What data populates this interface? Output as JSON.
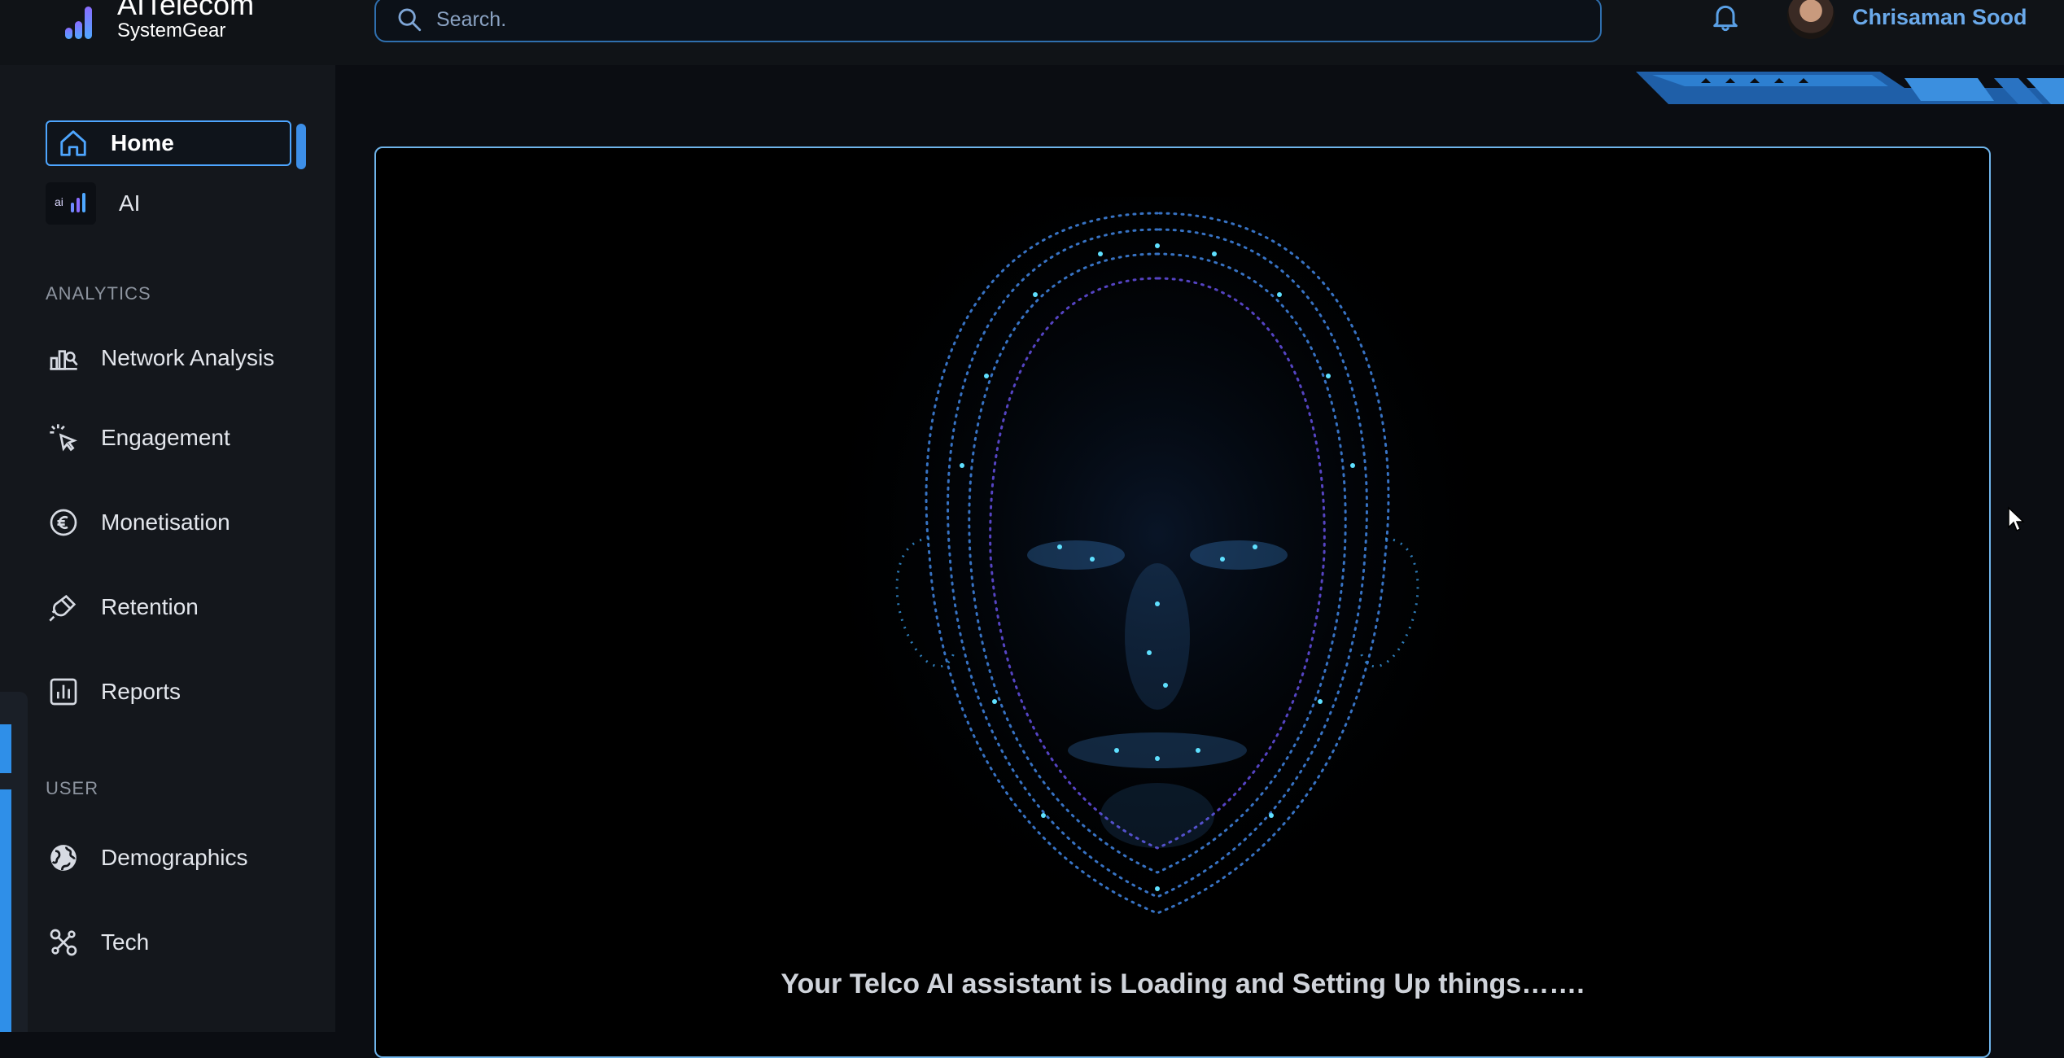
{
  "brand": {
    "name": "AITelecom",
    "subtitle": "SystemGear"
  },
  "search": {
    "placeholder": "Search."
  },
  "user": {
    "name": "Chrisaman Sood"
  },
  "sidebar": {
    "primary": [
      {
        "label": "Home",
        "icon": "home-icon",
        "active": true
      },
      {
        "label": "AI",
        "icon": "ai-logo-icon"
      }
    ],
    "sections": [
      {
        "title": "ANALYTICS",
        "items": [
          {
            "label": "Network Analysis",
            "icon": "analysis-chart-icon"
          },
          {
            "label": "Engagement",
            "icon": "click-icon"
          },
          {
            "label": "Monetisation",
            "icon": "euro-icon"
          },
          {
            "label": "Retention",
            "icon": "magnet-icon"
          },
          {
            "label": "Reports",
            "icon": "bar-chart-icon"
          }
        ]
      },
      {
        "title": "USER",
        "items": [
          {
            "label": "Demographics",
            "icon": "globe-icon"
          },
          {
            "label": "Tech",
            "icon": "tech-link-icon"
          }
        ]
      }
    ]
  },
  "main": {
    "status_text": "Your Telco AI assistant is Loading and Setting Up things……."
  },
  "colors": {
    "accent": "#4ea6ff",
    "panel_border": "#6fb4ea",
    "username": "#6aa9ea"
  }
}
